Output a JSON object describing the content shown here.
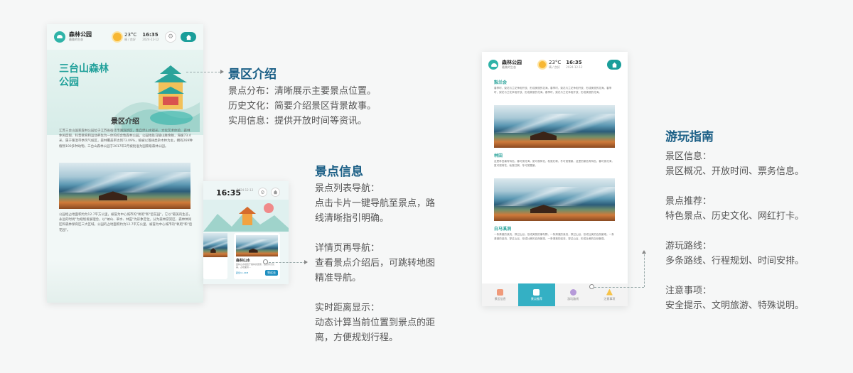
{
  "colors": {
    "accent": "#1a9e9a",
    "title_blue": "#1b5f86",
    "teal_text": "#2aa39a"
  },
  "app": {
    "name": "森林公园",
    "subtitle": "最美的生态",
    "temp": "23°C",
    "weather_sub": "晴 / 良好",
    "time": "16:35",
    "date": "2024-12-12"
  },
  "phone1": {
    "hero_title": "三台山森林公园",
    "section_title": "景区介绍",
    "para1": "江苏三台山国家森林公园位于江苏省宿迁市湖滨新区，集自然山水观光、文化艺术体验、森林休闲度假、科普教育和运动养生为一体的综合性森林公园。公园地处马陵山脉余脉，海拔73.4米，属于暖温带季风气候区，森林覆盖率达到73.09%，植被以落阔类杂木林为主，拥有269种植物100多种动物。三台山森林公园于2017年2月被批准为国家级森林公园。",
    "para2": "公园经占地面积约为12.7平方公里，被誉为中心城市的\"氧吧\"和\"后花园\"，它以\"最美的生态，永远的时尚\"为规划发展理念，以\"衲山、翠水、林田\"为形象定位，分为森林游赏区、森林休闲区和森林保育区三大区域。公园的占地面积约为12.7平方公里，被誉为中心城市的\"氧吧\"和\"后花园\"。"
  },
  "phone2": {
    "time": "16:35",
    "date": "2024-12-12",
    "card_title": "森林山水",
    "card_desc": "园林山水相连于森林的国家，自然风光优美，占地面积…",
    "distance": "距您11.2KM",
    "btn": "到这去"
  },
  "phone3": {
    "s1_title": "梨兰会",
    "s1_text": "春季时，梨花与兰花争相开放，形成美丽的花海。春季时，梨花与兰花争相开放，形成美丽的花海。春季时，梨花与兰花争相开放，形成美丽的花海。春季时，梨花与兰花争相开放，形成美丽的花海。",
    "s2_title": "林田",
    "s2_text": "这是林田最有特色，春可赏花海，夏可观荷花，秋赏红枫，冬可赏雪景。这里的景色有特色，春可赏花海，夏可观荷花，秋赏红枫，冬可赏雪景。",
    "s3_title": "白马溪洞",
    "s3_text": "一条清澈的溪流，穿过山谷，形成美丽的瀑布群。一条清澈的溪流，穿过山谷，形成壮美的自然景观。一条清澈的溪流，穿过山谷，形成壮美的自然景观，一条清澈的溪流，穿过山谷，形成壮美的自然景观。",
    "nav": [
      "景区信息",
      "景点推荐",
      "游玩路线",
      "注意事项"
    ]
  },
  "annot1": {
    "title": "景区介绍",
    "lines": [
      "景点分布：清晰展示主要景点位置。",
      "历史文化：简要介绍景区背景故事。",
      "实用信息：提供开放时间等资讯。"
    ]
  },
  "annot2": {
    "title": "景点信息",
    "g1": [
      "景点列表导航：",
      "点击卡片一键导航至景点，路",
      "线清晰指引明确。"
    ],
    "g2": [
      "详情页再导航：",
      "查看景点介绍后，可跳转地图",
      "精准导航。"
    ],
    "g3": [
      "实时距离显示：",
      "动态计算当前位置到景点的距",
      "离，方便规划行程。"
    ]
  },
  "annot3": {
    "title": "游玩指南",
    "g1": [
      "景区信息：",
      "景区概况、开放时间、票务信息。"
    ],
    "g2": [
      "景点推荐：",
      "特色景点、历史文化、网红打卡。"
    ],
    "g3": [
      "游玩路线：",
      "多条路线、行程规划、时间安排。"
    ],
    "g4": [
      "注意事项：",
      "安全提示、文明旅游、特殊说明。"
    ]
  }
}
